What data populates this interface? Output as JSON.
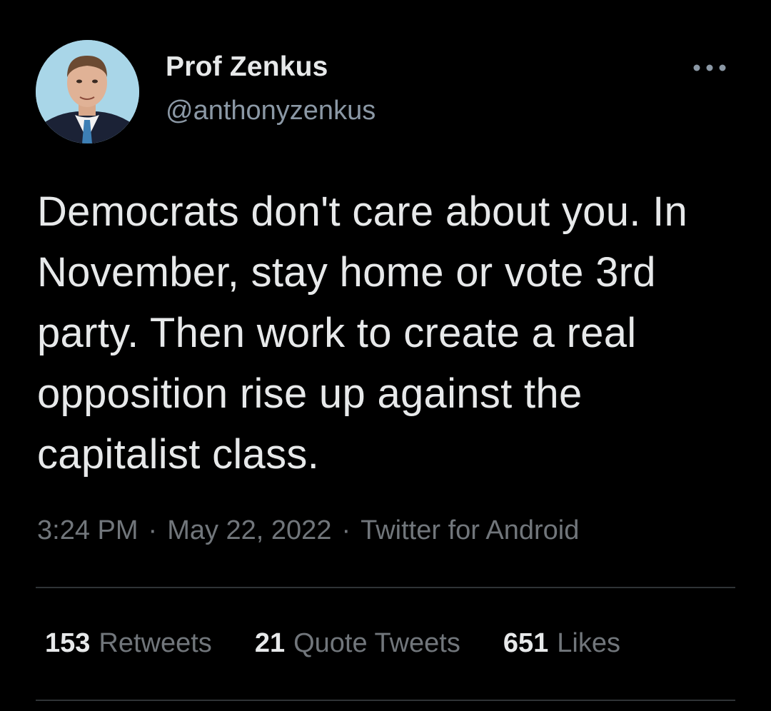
{
  "author": {
    "display_name": "Prof Zenkus",
    "handle": "@anthonyzenkus",
    "avatar_icon": "profile-photo"
  },
  "tweet": {
    "text": "Democrats don't care about you. In November, stay home or vote 3rd party. Then work to create a real opposition rise up against the capitalist class.",
    "time": "3:24 PM",
    "date": "May 22, 2022",
    "source": "Twitter for Android",
    "separator": "·"
  },
  "stats": {
    "retweets": {
      "count": "153",
      "label": "Retweets"
    },
    "quotes": {
      "count": "21",
      "label": "Quote Tweets"
    },
    "likes": {
      "count": "651",
      "label": "Likes"
    }
  },
  "colors": {
    "background": "#000000",
    "primary_text": "#e7e9ea",
    "secondary_text": "#71767b",
    "divider": "#2f3336"
  },
  "more_icon": "more-horizontal-icon"
}
